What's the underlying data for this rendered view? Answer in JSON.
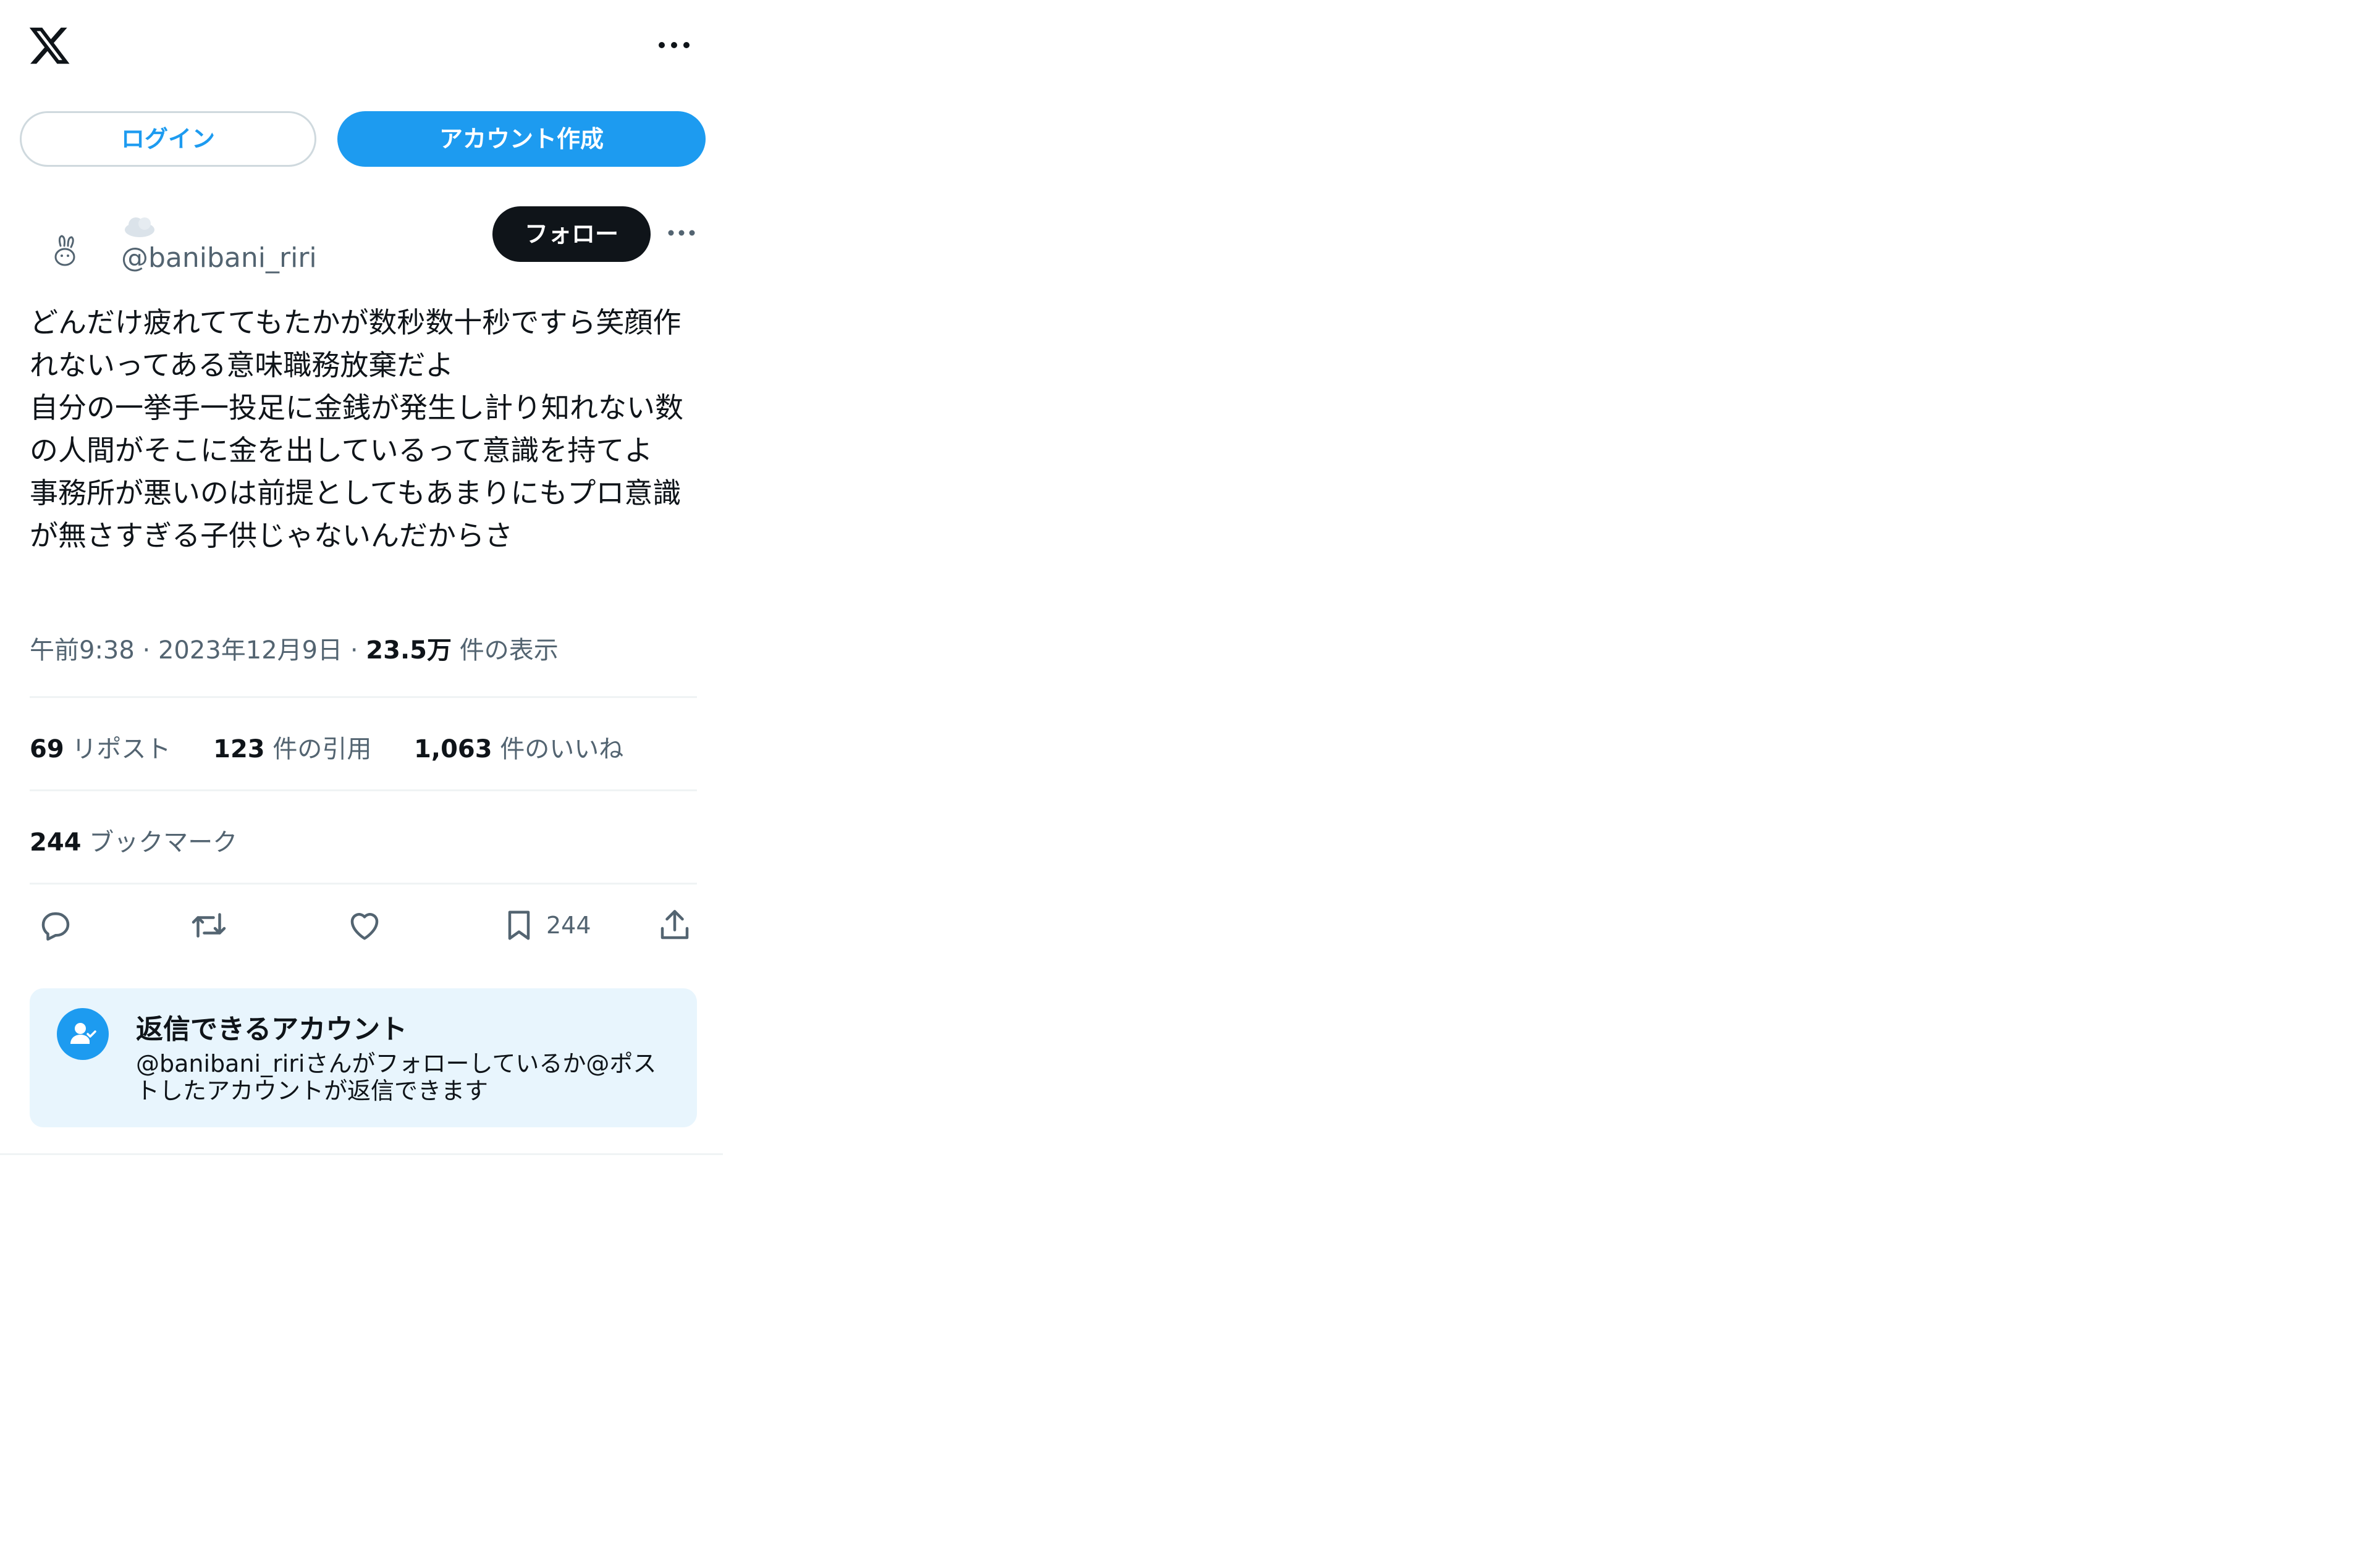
{
  "header": {
    "logo_icon": "x-logo-icon",
    "more_icon": "more-horizontal-icon"
  },
  "auth": {
    "login_label": "ログイン",
    "signup_label": "アカウント作成"
  },
  "author": {
    "avatar_icon": "rabbit-avatar-icon",
    "display_name_icon": "cloud-emoji-icon",
    "handle": "@banibani_riri",
    "follow_label": "フォロー",
    "more_icon": "more-horizontal-icon"
  },
  "tweet": {
    "text": "どんだけ疲れててもたかが数秒数十秒ですら笑顔作れないってある意味職務放棄だよ\n自分の一挙手一投足に金銭が発生し計り知れない数の人間がそこに金を出しているって意識を持てよ\n事務所が悪いのは前提としてもあまりにもプロ意識が無さすぎる子供じゃないんだからさ",
    "time": "午前9:38",
    "date": "2023年12月9日",
    "separator": "·",
    "views_count": "23.5万",
    "views_label": "件の表示"
  },
  "stats": {
    "reposts_count": "69",
    "reposts_label": "リポスト",
    "quotes_count": "123",
    "quotes_label": "件の引用",
    "likes_count": "1,063",
    "likes_label": "件のいいね",
    "bookmarks_count": "244",
    "bookmarks_label": "ブックマーク"
  },
  "actions": {
    "reply_icon": "reply-icon",
    "repost_icon": "repost-icon",
    "like_icon": "heart-icon",
    "bookmark_icon": "bookmark-icon",
    "bookmark_count": "244",
    "share_icon": "share-icon"
  },
  "reply_restriction": {
    "icon": "user-check-icon",
    "title": "返信できるアカウント",
    "description": "@banibani_ririさんがフォローしているか@ポストしたアカウントが返信できます"
  },
  "colors": {
    "accent": "#1d9bf0",
    "text": "#0f1419",
    "muted": "#536471",
    "divider": "#eff3f4",
    "reply_box_bg": "#e8f5fd"
  }
}
